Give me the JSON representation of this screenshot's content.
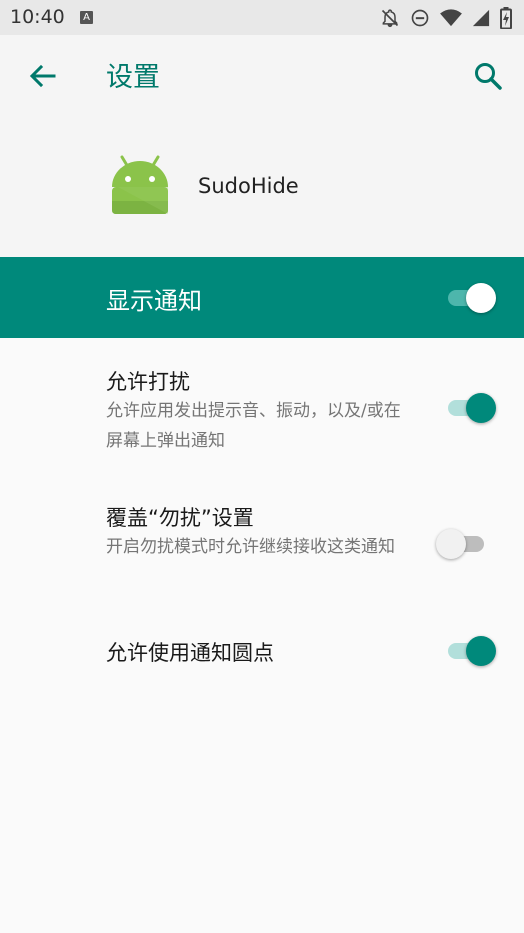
{
  "status_bar": {
    "time": "10:40",
    "notification_letter": "A"
  },
  "app_bar": {
    "title": "设置"
  },
  "app_info": {
    "name": "SudoHide"
  },
  "master_toggle": {
    "label": "显示通知",
    "on": true
  },
  "settings": [
    {
      "title": "允许打扰",
      "summary": "允许应用发出提示音、振动，以及/或在屏幕上弹出通知",
      "on": true
    },
    {
      "title": "覆盖“勿扰”设置",
      "summary": "开启勿扰模式时允许继续接收这类通知",
      "on": false
    },
    {
      "title": "允许使用通知圆点",
      "summary": "",
      "on": true
    }
  ],
  "colors": {
    "accent": "#00897b",
    "accent_dark": "#00796b",
    "android_green": "#8bc34a"
  }
}
